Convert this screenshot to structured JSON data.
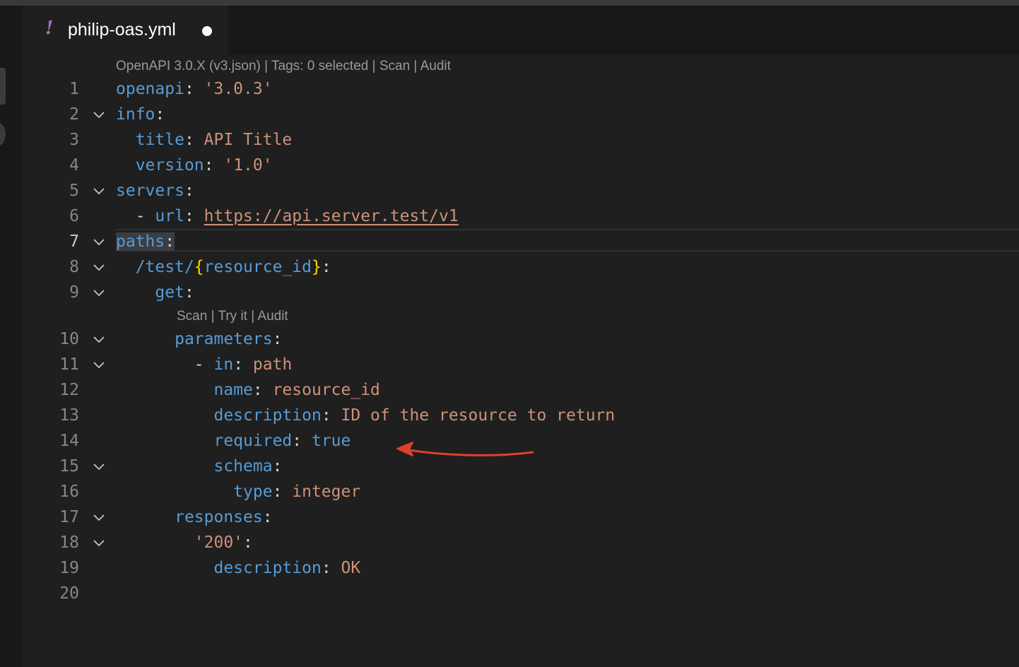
{
  "tab": {
    "icon": "yaml-exclamation-icon",
    "filename": "philip-oas.yml",
    "dirty": true
  },
  "codelens": {
    "top": "OpenAPI 3.0.X (v3.json) | Tags: 0 selected | Scan | Audit",
    "get": "Scan | Try it | Audit"
  },
  "editor": {
    "active_line": 7,
    "lines": [
      {
        "n": "1",
        "fold": false
      },
      {
        "n": "2",
        "fold": true
      },
      {
        "n": "3",
        "fold": false
      },
      {
        "n": "4",
        "fold": false
      },
      {
        "n": "5",
        "fold": true
      },
      {
        "n": "6",
        "fold": false
      },
      {
        "n": "7",
        "fold": true
      },
      {
        "n": "8",
        "fold": true
      },
      {
        "n": "9",
        "fold": true
      },
      {
        "n": "10",
        "fold": true
      },
      {
        "n": "11",
        "fold": true
      },
      {
        "n": "12",
        "fold": false
      },
      {
        "n": "13",
        "fold": false
      },
      {
        "n": "14",
        "fold": false
      },
      {
        "n": "15",
        "fold": true
      },
      {
        "n": "16",
        "fold": false
      },
      {
        "n": "17",
        "fold": true
      },
      {
        "n": "18",
        "fold": true
      },
      {
        "n": "19",
        "fold": false
      },
      {
        "n": "20",
        "fold": false
      }
    ],
    "code": {
      "l1_key": "openapi",
      "l1_val": "'3.0.3'",
      "l2_key": "info",
      "l3_key": "title",
      "l3_val": "API Title",
      "l4_key": "version",
      "l4_val": "'1.0'",
      "l5_key": "servers",
      "l6_dash": "-",
      "l6_key": "url",
      "l6_val": "https://api.server.test/v1",
      "l7_key": "paths",
      "l8_path": "/test/",
      "l8_brace_open": "{",
      "l8_param": "resource_id",
      "l8_brace_close": "}",
      "l9_key": "get",
      "l10_key": "parameters",
      "l11_dash": "-",
      "l11_key": "in",
      "l11_val": "path",
      "l12_key": "name",
      "l12_val": "resource_id",
      "l13_key": "description",
      "l13_val": "ID of the resource to return",
      "l14_key": "required",
      "l14_val": "true",
      "l15_key": "schema",
      "l16_key": "type",
      "l16_val": "integer",
      "l17_key": "responses",
      "l18_key": "'200'",
      "l19_key": "description",
      "l19_val": "OK"
    }
  },
  "annotation": {
    "color": "#e0402a",
    "icon": "red-arrow-annotation"
  }
}
